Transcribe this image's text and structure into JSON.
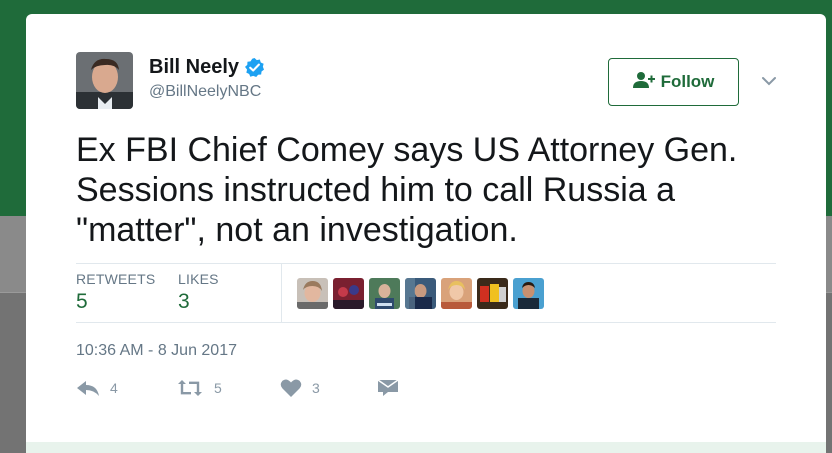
{
  "author": {
    "name": "Bill Neely",
    "handle": "@BillNeelyNBC",
    "verified": true
  },
  "follow_button": {
    "label": "Follow",
    "icon": "add-user-icon"
  },
  "more_menu_icon": "chevron-down-icon",
  "tweet": {
    "text": "Ex FBI Chief Comey says US Attorney Gen.\nSessions instructed him to call Russia a\n\"matter\", not an investigation."
  },
  "stats": {
    "retweets_label": "RETWEETS",
    "retweets_value": "5",
    "likes_label": "LIKES",
    "likes_value": "3"
  },
  "likers": [
    "avatar-1",
    "avatar-2",
    "avatar-3",
    "avatar-4",
    "avatar-5",
    "avatar-6",
    "avatar-7"
  ],
  "timestamp": "10:36 AM - 8 Jun 2017",
  "actions": {
    "reply_count": "4",
    "retweet_count": "5",
    "like_count": "3"
  },
  "colors": {
    "brand_green": "#1f6b3a",
    "text": "#14171a",
    "muted": "#657786",
    "verified_blue": "#1da1f2"
  }
}
